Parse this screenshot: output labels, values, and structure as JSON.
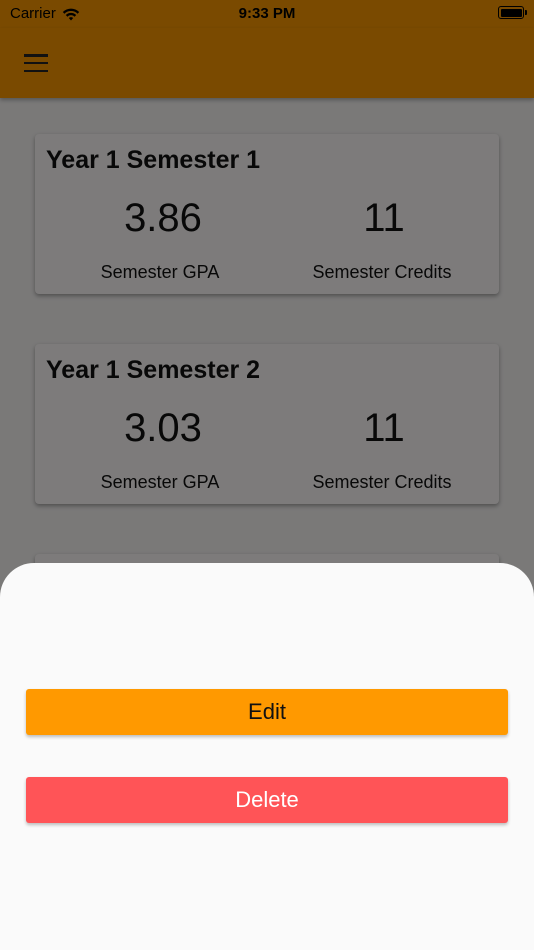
{
  "status_bar": {
    "carrier": "Carrier",
    "time": "9:33 PM",
    "icons": [
      "wifi-icon",
      "battery-icon"
    ]
  },
  "app_bar": {
    "menu_icon": "hamburger-menu-icon",
    "color": "#f59500"
  },
  "semesters": [
    {
      "title": "Year 1 Semester 1",
      "gpa": "3.86",
      "gpa_label": "Semester GPA",
      "credits": "11",
      "credits_label": "Semester Credits"
    },
    {
      "title": "Year 1 Semester 2",
      "gpa": "3.03",
      "gpa_label": "Semester GPA",
      "credits": "11",
      "credits_label": "Semester Credits"
    }
  ],
  "sheet": {
    "edit_label": "Edit",
    "delete_label": "Delete",
    "edit_color": "#ff9900",
    "delete_color": "#ff5457"
  }
}
